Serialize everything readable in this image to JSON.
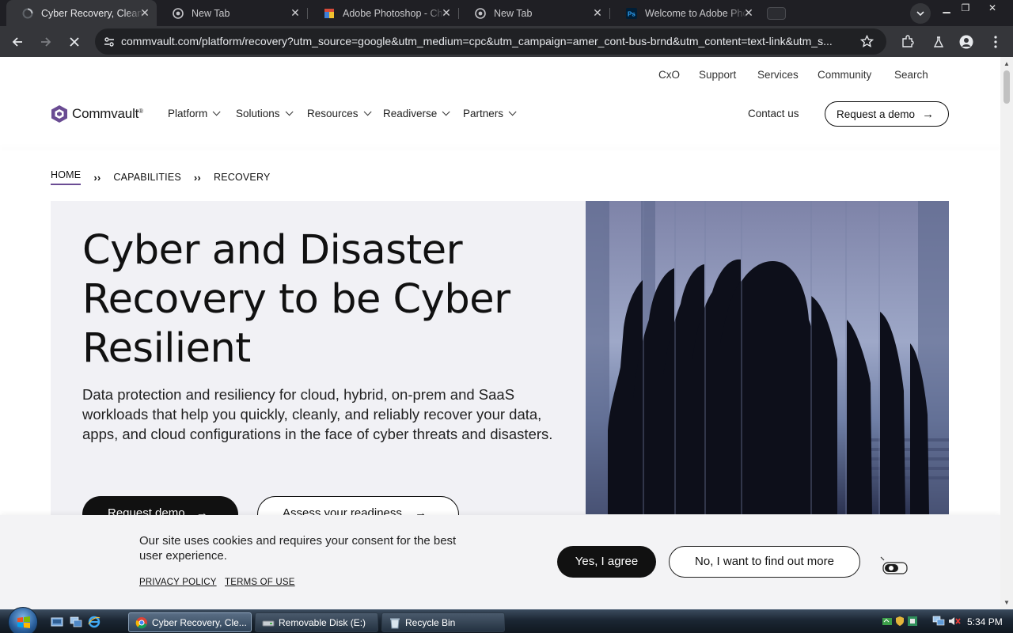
{
  "browser": {
    "tabs": [
      {
        "title": "Cyber Recovery, Clean and Reliable",
        "active": true,
        "icon": "loading-icon"
      },
      {
        "title": "New Tab",
        "active": false,
        "icon": "chrome-icon"
      },
      {
        "title": "Adobe Photoshop - Chrome",
        "active": false,
        "icon": "photoshop-page-icon"
      },
      {
        "title": "New Tab",
        "active": false,
        "icon": "chrome-icon"
      },
      {
        "title": "Welcome to Adobe Photoshop",
        "active": false,
        "icon": "ps-icon"
      }
    ],
    "url": "commvault.com/platform/recovery?utm_source=google&utm_medium=cpc&utm_campaign=amer_cont-bus-brnd&utm_content=text-link&utm_s..."
  },
  "site": {
    "utility_nav": [
      "CxO",
      "Support",
      "Services",
      "Community",
      "Search"
    ],
    "logo_text": "Commvault",
    "logo_mark": "®",
    "main_nav": [
      "Platform",
      "Solutions",
      "Resources",
      "Readiverse",
      "Partners"
    ],
    "contact": "Contact us",
    "request_demo": "Request a demo",
    "breadcrumb": [
      "HOME",
      "CAPABILITIES",
      "RECOVERY"
    ],
    "hero": {
      "title": "Cyber and Disaster Recovery to be Cyber Resilient",
      "description": "Data protection and resiliency for cloud, hybrid, on-prem and SaaS workloads that help you quickly, cleanly, and reliably recover your data, apps, and cloud configurations in the face of cyber threats and disasters.",
      "primary_cta": "Request demo",
      "secondary_cta": "Assess your readiness"
    },
    "cookie": {
      "message": "Our site uses cookies and requires your consent for the best user experience.",
      "privacy": "PRIVACY POLICY",
      "terms": "TERMS OF USE",
      "agree": "Yes, I agree",
      "find_out": "No, I want to find out more"
    }
  },
  "taskbar": {
    "items": [
      {
        "label": "Cyber Recovery, Cle...",
        "active": true
      },
      {
        "label": "Removable Disk (E:)",
        "active": false
      },
      {
        "label": "Recycle Bin",
        "active": false
      }
    ],
    "clock": "5:34 PM"
  },
  "colors": {
    "accent": "#6a4c93",
    "dark": "#111111",
    "hero_bg": "#f1f1f5"
  }
}
